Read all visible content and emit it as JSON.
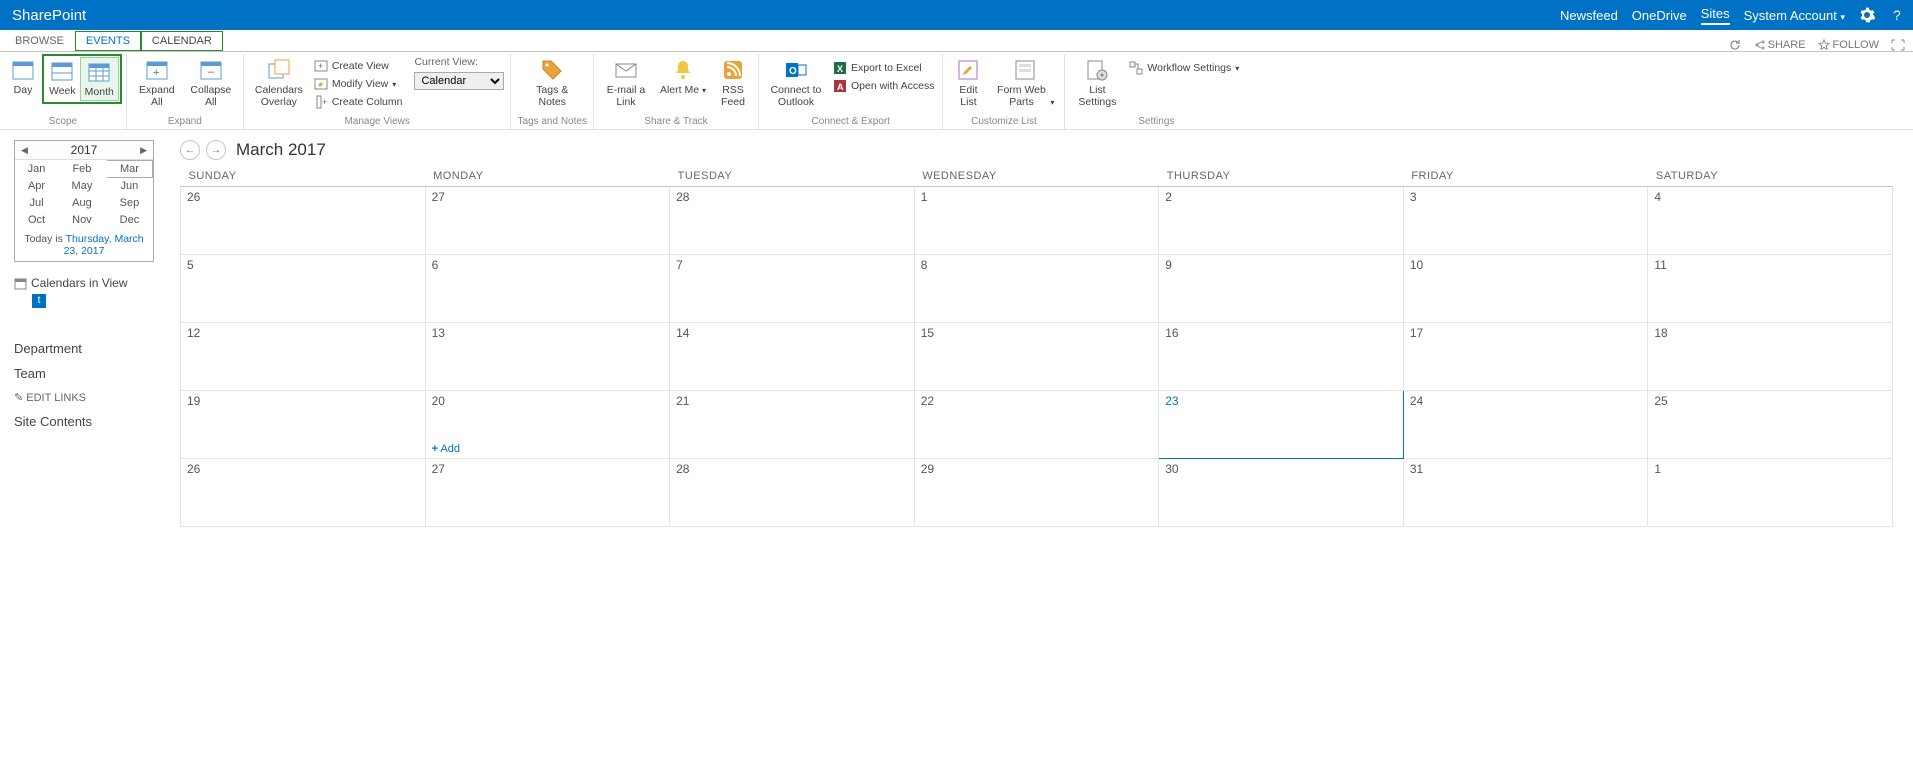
{
  "topbar": {
    "brand": "SharePoint",
    "links": {
      "newsfeed": "Newsfeed",
      "onedrive": "OneDrive",
      "sites": "Sites"
    },
    "account": "System Account"
  },
  "tabs": {
    "browse": "BROWSE",
    "events": "EVENTS",
    "calendar": "CALENDAR"
  },
  "rightops": {
    "share": "SHARE",
    "follow": "FOLLOW"
  },
  "ribbon": {
    "scope": {
      "label": "Scope",
      "day": "Day",
      "week": "Week",
      "month": "Month"
    },
    "expand": {
      "label": "Expand",
      "expand": "Expand All",
      "collapse": "Collapse All"
    },
    "manage": {
      "label": "Manage Views",
      "overlay": "Calendars Overlay",
      "createView": "Create View",
      "modifyView": "Modify View",
      "createColumn": "Create Column",
      "currentViewLabel": "Current View:",
      "currentViewValue": "Calendar"
    },
    "tagsnotes": {
      "label": "Tags and Notes",
      "tags": "Tags & Notes"
    },
    "sharetrack": {
      "label": "Share & Track",
      "email": "E-mail a Link",
      "alert": "Alert Me",
      "rss": "RSS Feed"
    },
    "connect": {
      "label": "Connect & Export",
      "outlook": "Connect to Outlook",
      "excel": "Export to Excel",
      "access": "Open with Access"
    },
    "customize": {
      "label": "Customize List",
      "editlist": "Edit List",
      "formweb": "Form Web Parts",
      "listset": "List Settings"
    },
    "settings": {
      "label": "Settings",
      "workflow": "Workflow Settings"
    }
  },
  "minical": {
    "year": "2017",
    "months": [
      "Jan",
      "Feb",
      "Mar",
      "Apr",
      "May",
      "Jun",
      "Jul",
      "Aug",
      "Sep",
      "Oct",
      "Nov",
      "Dec"
    ],
    "current": "Mar",
    "todayPrefix": "Today is ",
    "todayLink": "Thursday, March 23, 2017"
  },
  "calinview": {
    "label": "Calendars in View",
    "item": "t"
  },
  "nav": {
    "department": "Department",
    "team": "Team",
    "edit": "EDIT LINKS",
    "contents": "Site Contents"
  },
  "bigcal": {
    "title": "March 2017",
    "days": [
      "SUNDAY",
      "MONDAY",
      "TUESDAY",
      "WEDNESDAY",
      "THURSDAY",
      "FRIDAY",
      "SATURDAY"
    ],
    "weeks": [
      [
        "26",
        "27",
        "28",
        "1",
        "2",
        "3",
        "4"
      ],
      [
        "5",
        "6",
        "7",
        "8",
        "9",
        "10",
        "11"
      ],
      [
        "12",
        "13",
        "14",
        "15",
        "16",
        "17",
        "18"
      ],
      [
        "19",
        "20",
        "21",
        "22",
        "23",
        "24",
        "25"
      ],
      [
        "26",
        "27",
        "28",
        "29",
        "30",
        "31",
        "1"
      ]
    ],
    "today": "23",
    "add": "Add"
  }
}
